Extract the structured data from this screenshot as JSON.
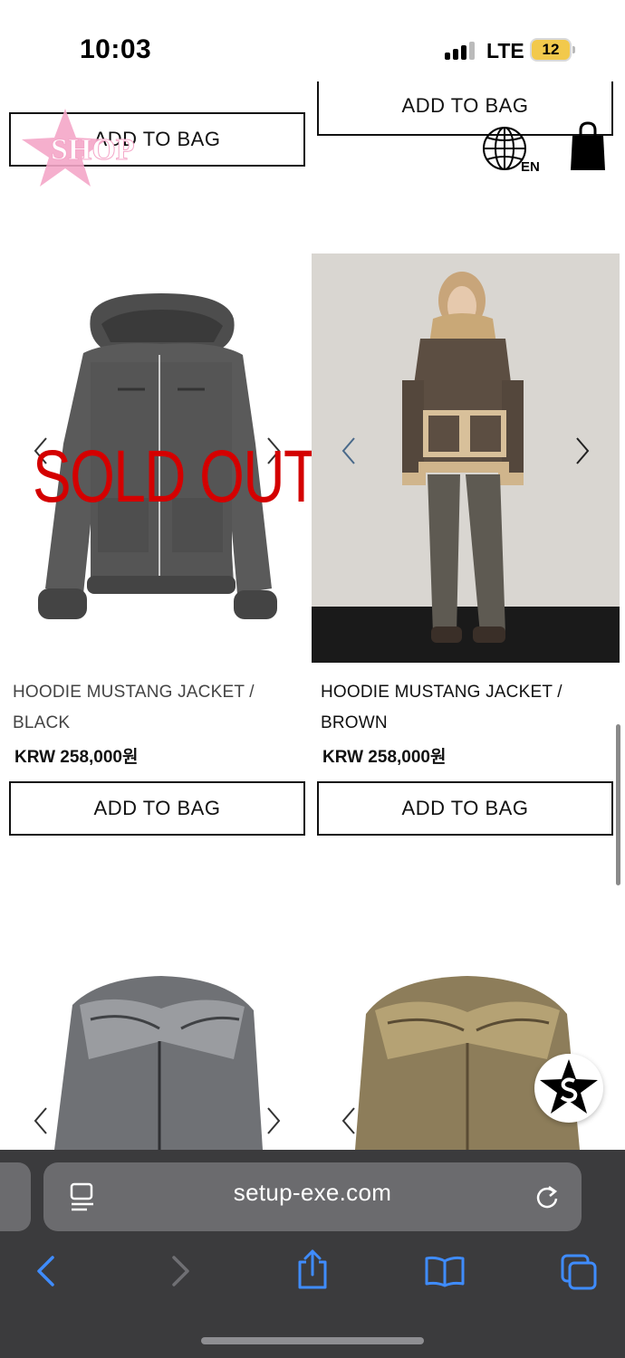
{
  "status_bar": {
    "time": "10:03",
    "network": "LTE",
    "battery": "12"
  },
  "header": {
    "logo_text": "SHOP",
    "language": "EN"
  },
  "products": [
    {
      "add_to_bag_label": "ADD TO BAG"
    },
    {
      "add_to_bag_label": "ADD TO BAG"
    },
    {
      "name": "HOODIE MUSTANG JACKET / BLACK",
      "name_line1": "HOODIE MUSTANG JACKET /",
      "name_line2": "BLACK",
      "price": "KRW 258,000원",
      "badge": "SOLD OUT",
      "add_to_bag_label": "ADD TO BAG"
    },
    {
      "name": "HOODIE MUSTANG JACKET / BROWN",
      "name_line1": "HOODIE MUSTANG JACKET /",
      "name_line2": "BROWN",
      "price": "KRW 258,000원",
      "add_to_bag_label": "ADD TO BAG"
    }
  ],
  "browser": {
    "url": "setup-exe.com"
  },
  "icons": {
    "logo": "star-logo-icon",
    "globe": "globe-icon",
    "bag": "shopping-bag-icon",
    "float": "star-s-icon",
    "back": "chevron-left-icon",
    "forward": "chevron-right-icon",
    "share": "share-icon",
    "bookmarks": "book-icon",
    "tabs": "tabs-icon",
    "reload": "reload-icon",
    "reader": "page-menu-icon"
  },
  "colors": {
    "sold_out": "#d40000",
    "logo_pink": "#f4a6c8",
    "safari_blue": "#3f8cff"
  }
}
